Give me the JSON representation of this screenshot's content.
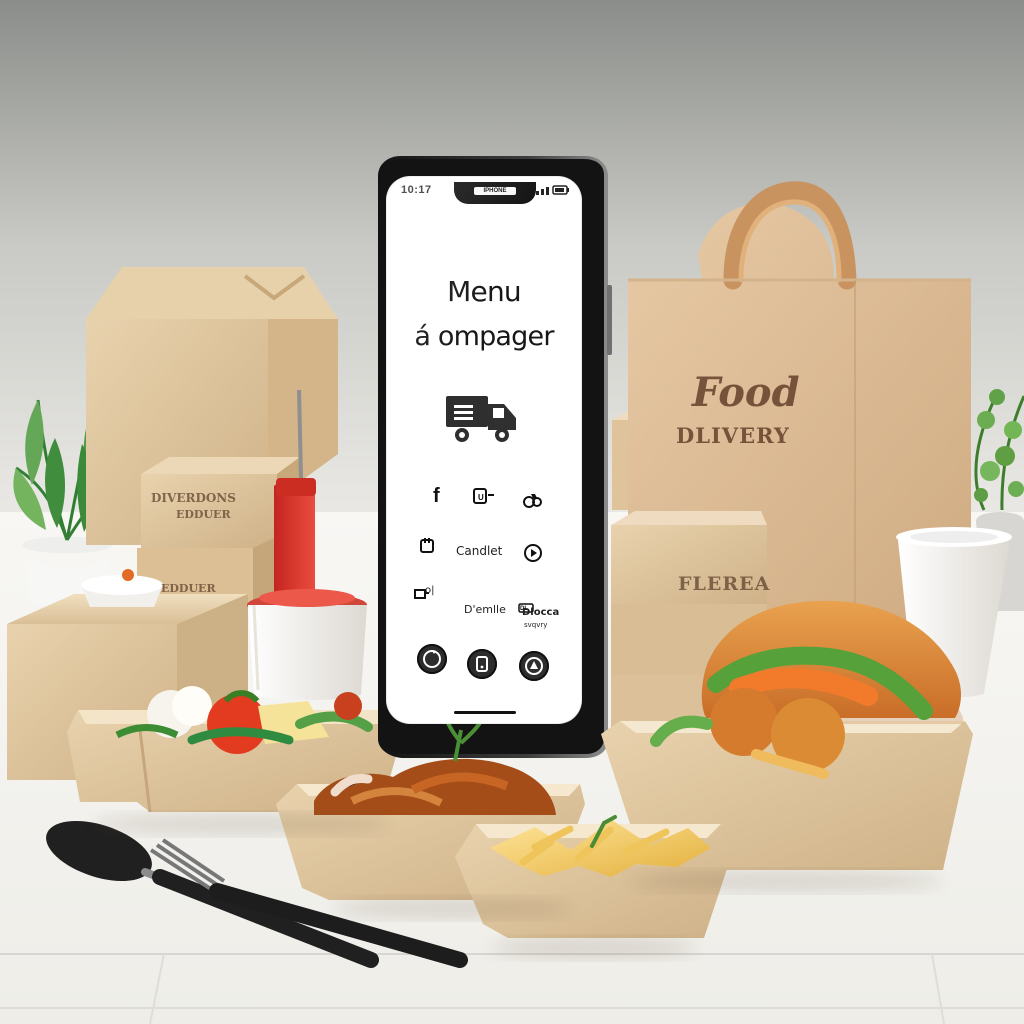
{
  "phone": {
    "status_time": "10:17",
    "notch_label": "IPHONE",
    "title_line1": "Menu",
    "title_line2": "á ompager",
    "icons": [
      {
        "name": "facebook-icon"
      },
      {
        "name": "instagram-icon"
      },
      {
        "name": "bike-icon"
      },
      {
        "name": "calendar-icon"
      },
      {
        "name": "play-icon"
      },
      {
        "name": "wallet-icon"
      },
      {
        "name": "location-icon"
      },
      {
        "name": "chat-icon"
      },
      {
        "name": "profile-icon"
      }
    ],
    "label_center": "Candlet",
    "label_mid": "D'emlle",
    "label_right": "Dlocca",
    "label_right_sub": "svqvry",
    "label_left_sub": "o|",
    "bottom_nav": [
      {
        "name": "refresh-icon"
      },
      {
        "name": "phone-icon"
      },
      {
        "name": "delivery-icon"
      }
    ]
  },
  "scene": {
    "left_box_label_line1": "DIVERDONS",
    "left_box_label_line2": "EDDUER",
    "left_bottom_box_label": "EDDUER",
    "stack_box_label": "FLEREA",
    "bag_label_line1": "Food",
    "bag_label_line2": "DLIVERY"
  }
}
